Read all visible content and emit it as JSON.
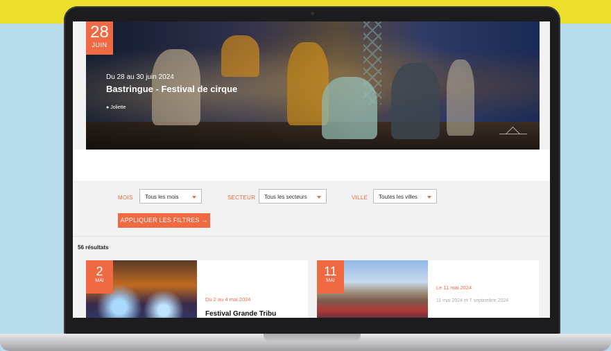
{
  "hero": {
    "badge_day": "28",
    "badge_month": "JUIN",
    "subtitle": "Du 28 au 30 juin 2024",
    "title": "Bastringue - Festival de cirque",
    "location": "Joliette"
  },
  "filters": {
    "month_label": "MOIS",
    "month_value": "Tous les mois",
    "sector_label": "SECTEUR",
    "sector_value": "Tous les secteurs",
    "city_label": "VILLE",
    "city_value": "Toutes les villes",
    "apply_label": "APPLIQUER LES FILTRES"
  },
  "results": {
    "count": "56 résultats"
  },
  "cards": [
    {
      "day": "2",
      "month": "MAI",
      "date": "Du 2 au 4 mai 2024",
      "extra": "",
      "title": "Festival Grande Tribu"
    },
    {
      "day": "11",
      "month": "MAI",
      "date": "Le 11 mai 2024",
      "extra": "11 mai 2024 et 7 septembre 2024",
      "title": ""
    }
  ],
  "colors": {
    "accent": "#ef6a43",
    "background": "#b7dbe9",
    "band": "#ecdf2c"
  }
}
